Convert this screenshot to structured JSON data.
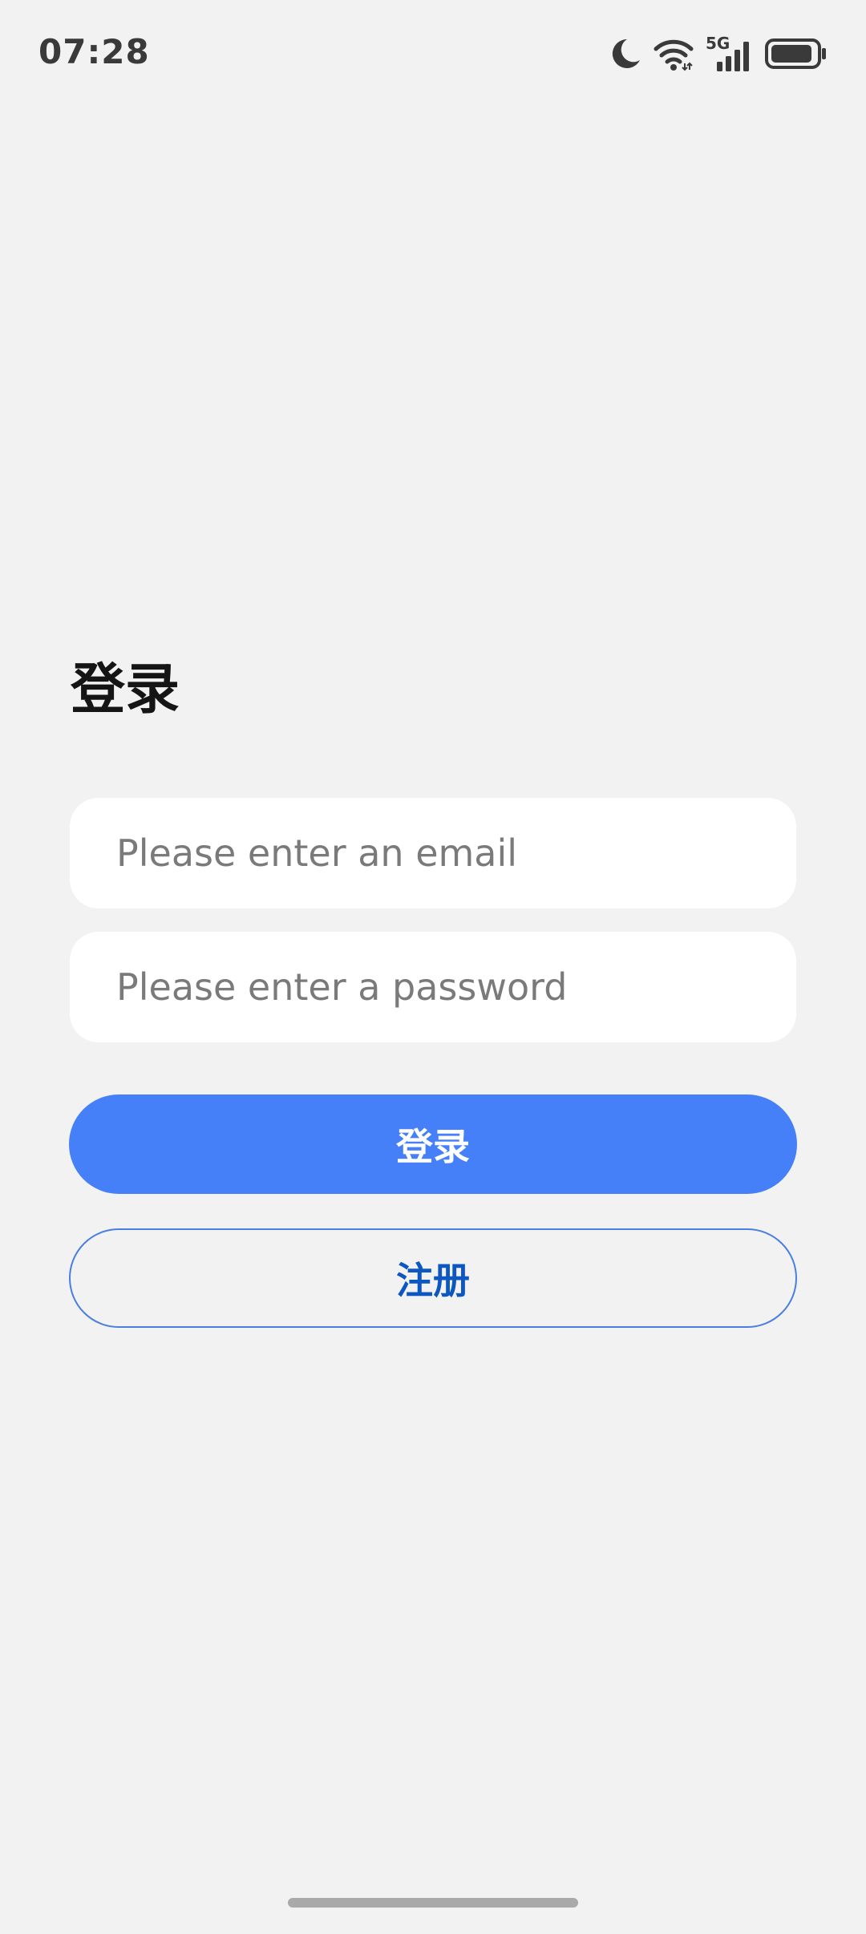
{
  "status_bar": {
    "time": "07:28",
    "network_label": "5G",
    "icons": [
      "moon-icon",
      "wifi-icon",
      "cellular-signal-icon",
      "battery-icon"
    ]
  },
  "login": {
    "title": "登录",
    "email_placeholder": "Please enter an email",
    "email_value": "",
    "password_placeholder": "Please enter a password",
    "password_value": "",
    "login_button": "登录",
    "register_button": "注册"
  },
  "colors": {
    "background": "#f2f2f2",
    "primary": "#4680f8",
    "outline": "#4a7fe0",
    "secondary_text": "#0d57c0"
  }
}
